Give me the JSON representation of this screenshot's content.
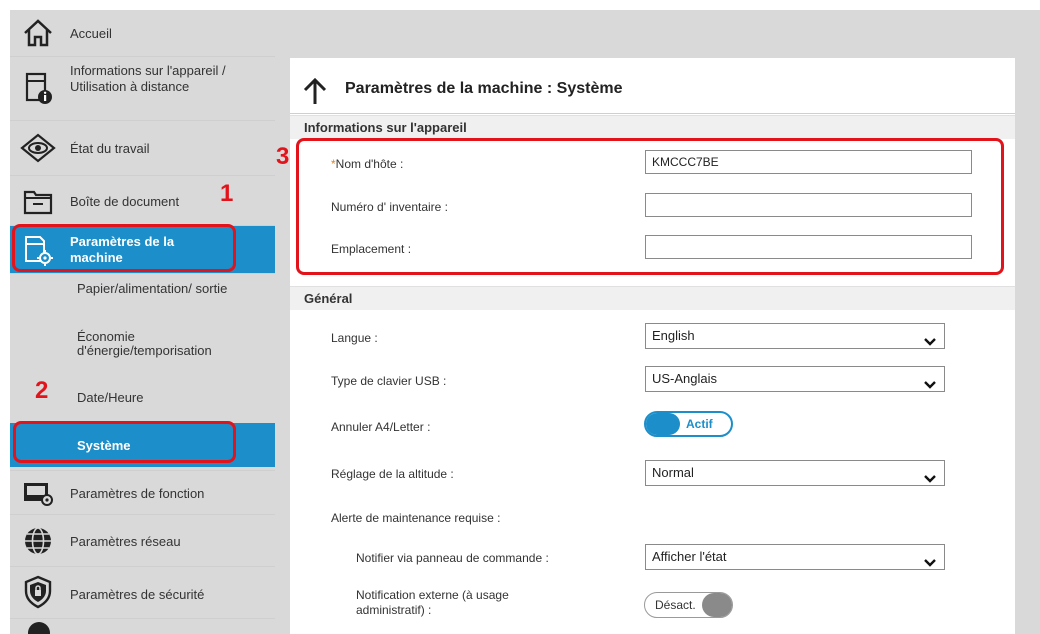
{
  "sidebar": {
    "items": [
      {
        "label": "Accueil",
        "icon": "home-icon"
      },
      {
        "label": "Informations sur l'appareil / Utilisation à distance",
        "icon": "device-info-icon"
      },
      {
        "label": "État du travail",
        "icon": "eye-icon"
      },
      {
        "label": "Boîte de document",
        "icon": "folder-icon"
      },
      {
        "label": "Paramètres de la machine",
        "icon": "machine-settings-icon"
      },
      {
        "label": "Paramètres de fonction",
        "icon": "function-settings-icon"
      },
      {
        "label": "Paramètres réseau",
        "icon": "globe-icon"
      },
      {
        "label": "Paramètres de sécurité",
        "icon": "shield-lock-icon"
      }
    ],
    "subitems": [
      {
        "label": "Papier/alimentation/ sortie"
      },
      {
        "label": "Économie d'énergie/temporisation"
      },
      {
        "label": "Date/Heure"
      },
      {
        "label": "Système"
      }
    ],
    "active_item": "Paramètres de la machine",
    "active_subitem": "Système"
  },
  "page": {
    "title": "Paramètres de la machine : Système"
  },
  "device_info": {
    "heading": "Informations sur l'appareil",
    "required_mark": "*",
    "hostname_label": "Nom d'hôte :",
    "hostname_value": "KMCCC7BE",
    "asset_label": "Numéro d' inventaire :",
    "asset_value": "",
    "location_label": "Emplacement :",
    "location_value": ""
  },
  "general": {
    "heading": "Général",
    "language_label": "Langue :",
    "language_value": "English",
    "usb_keyboard_label": "Type de clavier USB :",
    "usb_keyboard_value": "US-Anglais",
    "override_label": "Annuler A4/Letter  :",
    "override_value": "Actif",
    "altitude_label": "Réglage de la altitude :",
    "altitude_value": "Normal",
    "maintenance_label": "Alerte de maintenance requise :",
    "panel_notify_label": "Notifier via panneau de commande :",
    "panel_notify_value": "Afficher l'état",
    "external_notify_label": "Notification externe (à usage administratif) :",
    "external_notify_value": "Désact."
  },
  "callouts": {
    "one": "1",
    "two": "2",
    "three": "3"
  },
  "colors": {
    "accent": "#1c8ec9",
    "callout": "#e3131b",
    "sidebar_bg": "#d9d9d9"
  }
}
